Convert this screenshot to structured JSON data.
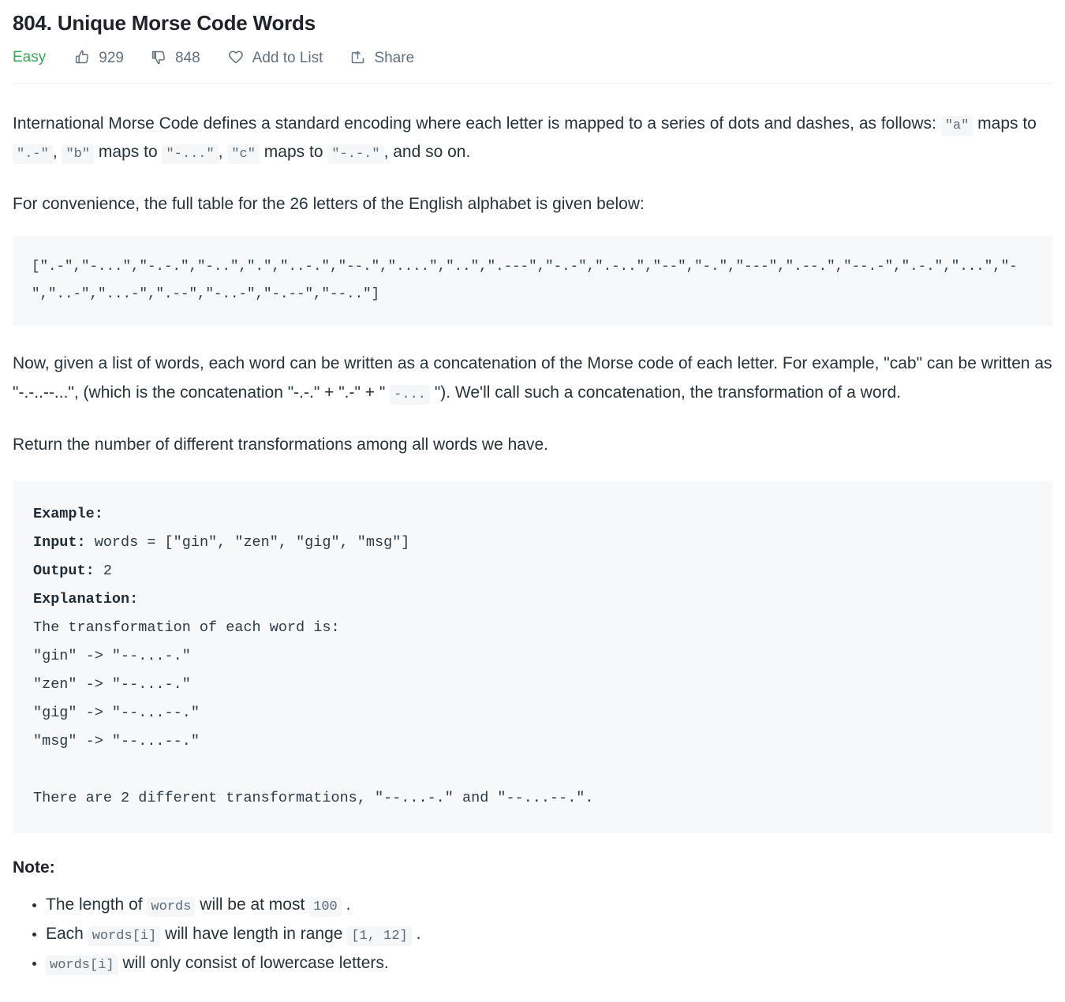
{
  "header": {
    "title": "804. Unique Morse Code Words",
    "difficulty": "Easy",
    "likes": "929",
    "dislikes": "848",
    "add_to_list": "Add to List",
    "share": "Share",
    "icons": {
      "like": "thumbs-up-icon",
      "dislike": "thumbs-down-icon",
      "favorite": "heart-icon",
      "share": "share-icon"
    },
    "colors": {
      "easy": "#3aa757",
      "meta_text": "#62717d",
      "divider": "#eceff1"
    }
  },
  "description": {
    "p1_a": "International Morse Code defines a standard encoding where each letter is mapped to a series of dots and dashes, as follows: ",
    "p1_code_a": "\"a\"",
    "p1_b": " maps to ",
    "p1_code_b": "\".-\"",
    "p1_c": ", ",
    "p1_code_c": "\"b\"",
    "p1_d": " maps to ",
    "p1_code_d": "\"-...\"",
    "p1_e": ", ",
    "p1_code_e": "\"c\"",
    "p1_f": " maps to ",
    "p1_code_f": "\"-.-.\"",
    "p1_g": ", and so on.",
    "p2": "For convenience, the full table for the 26 letters of the English alphabet is given below:",
    "morse_table": "[\".-\",\"-...\",\"-.-.\",\"-..\",\".\",\"..-.\",\"--.\",\"....\",\"..\",\".---\",\"-.-\",\".-..\",\"--\",\"-.\",\"---\",\".--.\",\"--.-\",\".-.\",\"...\",\"-\",\"..-\",\"...-\",\".--\",\"-..-\",\"-.--\",\"--..\"]",
    "p3_a": "Now, given a list of words, each word can be written as a concatenation of the Morse code of each letter. For example, \"cab\" can be written as \"-.-..--...\", (which is the concatenation \"-.-.\" + \".-\" + \" ",
    "p3_code": "-...",
    "p3_b": " \"). We'll call such a concatenation, the transformation of a word.",
    "p4": "Return the number of different transformations among all words we have."
  },
  "example": {
    "label_example": "Example:",
    "label_input": "Input:",
    "input_value": " words = [\"gin\", \"zen\", \"gig\", \"msg\"]",
    "label_output": "Output:",
    "output_value": " 2",
    "label_explanation": "Explanation:",
    "explanation_intro": "The transformation of each word is:",
    "transformations": [
      "\"gin\" -> \"--...-.\"",
      "\"zen\" -> \"--...-.\"",
      "\"gig\" -> \"--...--.\"",
      "\"msg\" -> \"--...--.\""
    ],
    "conclusion": "There are 2 different transformations, \"--...-.\" and \"--...--.\"."
  },
  "note": {
    "heading": "Note:",
    "items": [
      {
        "pre": "The length of ",
        "code1": "words",
        "mid": " will be at most ",
        "code2": "100",
        "post": " ."
      },
      {
        "pre": "Each ",
        "code1": "words[i]",
        "mid": " will have length in range ",
        "code2": "[1, 12]",
        "post": " ."
      },
      {
        "pre": "",
        "code1": "words[i]",
        "mid": " will only consist of lowercase letters.",
        "code2": "",
        "post": ""
      }
    ]
  }
}
